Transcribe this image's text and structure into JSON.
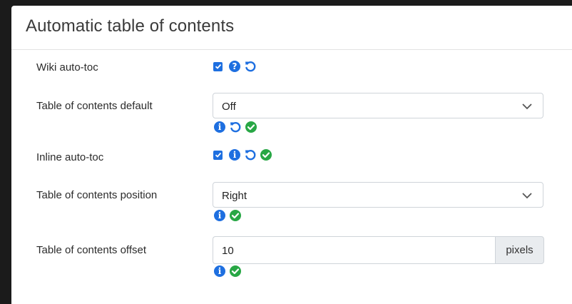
{
  "panel": {
    "title": "Automatic table of contents"
  },
  "rows": {
    "wiki_autotoc": {
      "label": "Wiki auto-toc",
      "checked": true,
      "icons": [
        "question-icon",
        "reset-icon"
      ]
    },
    "toc_default": {
      "label": "Table of contents default",
      "value": "Off",
      "icons": [
        "info-icon",
        "reset-icon",
        "check-icon"
      ]
    },
    "inline_autotoc": {
      "label": "Inline auto-toc",
      "checked": true,
      "icons": [
        "info-icon",
        "reset-icon",
        "check-icon"
      ]
    },
    "toc_position": {
      "label": "Table of contents position",
      "value": "Right",
      "icons": [
        "info-icon",
        "check-icon"
      ]
    },
    "toc_offset": {
      "label": "Table of contents offset",
      "value": "10",
      "unit": "pixels",
      "icons": [
        "info-icon",
        "check-icon"
      ]
    }
  },
  "colors": {
    "accent_blue": "#1e6fe0",
    "success_green": "#28a745",
    "page_bg": "#1b1b1b",
    "panel_bg": "#ffffff"
  }
}
